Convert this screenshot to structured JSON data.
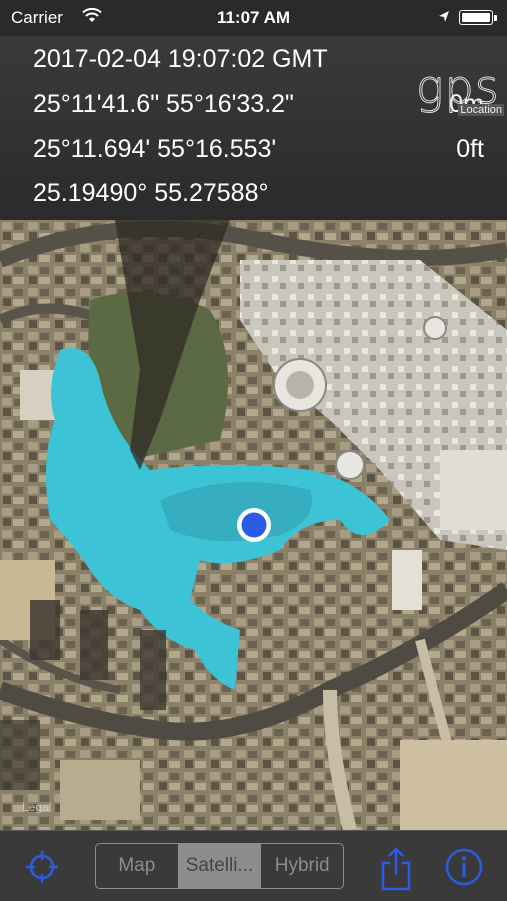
{
  "status_bar": {
    "carrier": "Carrier",
    "time": "11:07 AM"
  },
  "info": {
    "datetime": "2017-02-04   19:07:02 GMT",
    "dms": "25°11'41.6\" 55°16'33.2\"",
    "dm": "25°11.694' 55°16.553'",
    "dd": "25.19490° 55.27588°",
    "altitude_m": "0m",
    "altitude_ft": "0ft"
  },
  "logo": {
    "text": "gps",
    "subtext": "Location"
  },
  "map": {
    "legal_label": "Legal"
  },
  "toolbar": {
    "segments": [
      "Map",
      "Satelli...",
      "Hybrid"
    ],
    "selected_index": 1
  },
  "colors": {
    "accent": "#2b5ce6",
    "water": "#3cc4d6",
    "toolbar_bg": "#3a3a3a"
  }
}
